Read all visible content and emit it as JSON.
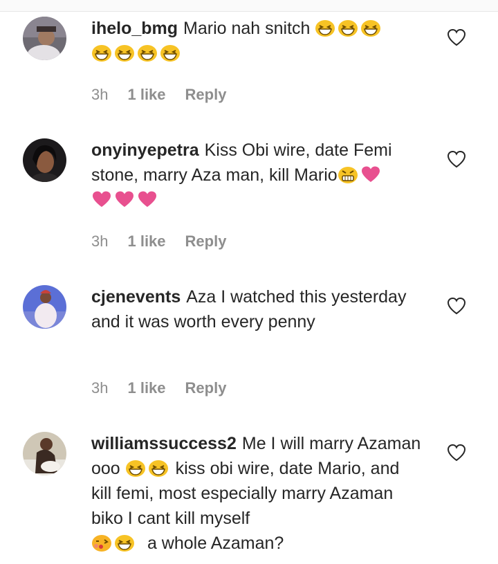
{
  "comments": [
    {
      "username": "ihelo_bmg",
      "text": "Mario nah snitch",
      "time": "3h",
      "likes": "1 like",
      "reply": "Reply",
      "emoji_after": "grin-x7"
    },
    {
      "username": "onyinyepetra",
      "text": "Kiss Obi wire, date Femi stone, marry Aza man, kill Mario",
      "time": "3h",
      "likes": "1 like",
      "reply": "Reply",
      "emoji_after": "grimace,heart-x4"
    },
    {
      "username": "cjenevents",
      "text": "Aza I watched this yesterday and it was worth every penny",
      "time": "3h",
      "likes": "1 like",
      "reply": "Reply"
    },
    {
      "username": "williamssuccess2",
      "text_1": "Me I will marry Azaman ooo",
      "text_2": "kiss obi wire, date Mario, and kill femi, most especially marry Azaman biko I cant kill myself",
      "text_3": "a whole Azaman?"
    }
  ],
  "colors": {
    "text": "#262626",
    "meta": "#8e8e8e",
    "emoji_face": "#f7c325",
    "heart_pink": "#e8508f"
  },
  "icons": {
    "like_button": "heart-outline-icon",
    "emoji": "grinning-squinting-face-icon"
  }
}
